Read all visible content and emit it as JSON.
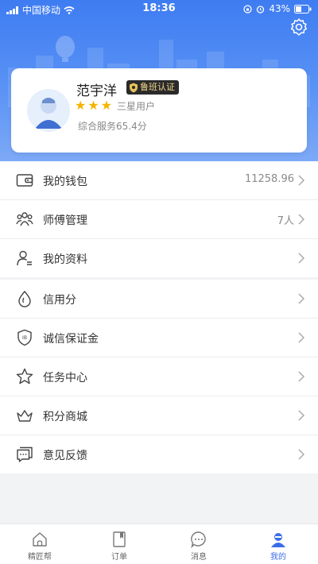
{
  "status_bar": {
    "carrier": "中国移动",
    "time": "18:36",
    "battery": "43%"
  },
  "profile": {
    "name": "范宇洋",
    "badge": "鲁班认证",
    "stars": 3,
    "level": "三星用户",
    "service": "综合服务65.4分"
  },
  "menu_group_1": [
    {
      "label": "我的钱包",
      "value": "11258.96",
      "icon": "wallet-icon"
    },
    {
      "label": "师傅管理",
      "value": "7人",
      "icon": "team-icon"
    },
    {
      "label": "我的资料",
      "value": "",
      "icon": "profile-icon"
    }
  ],
  "menu_group_2": [
    {
      "label": "信用分",
      "icon": "drop-icon"
    },
    {
      "label": "诚信保证金",
      "icon": "shield-icon"
    },
    {
      "label": "任务中心",
      "icon": "star-icon"
    },
    {
      "label": "积分商城",
      "icon": "crown-icon"
    },
    {
      "label": "意见反馈",
      "icon": "feedback-icon"
    }
  ],
  "tabs": [
    {
      "label": "精匠帮",
      "icon": "home-icon",
      "active": false
    },
    {
      "label": "订单",
      "icon": "order-icon",
      "active": false
    },
    {
      "label": "消息",
      "icon": "message-icon",
      "active": false
    },
    {
      "label": "我的",
      "icon": "user-icon",
      "active": true
    }
  ],
  "colors": {
    "brand": "#3e7cf1",
    "star": "#f5b400",
    "active_tab": "#3a6ee8"
  }
}
